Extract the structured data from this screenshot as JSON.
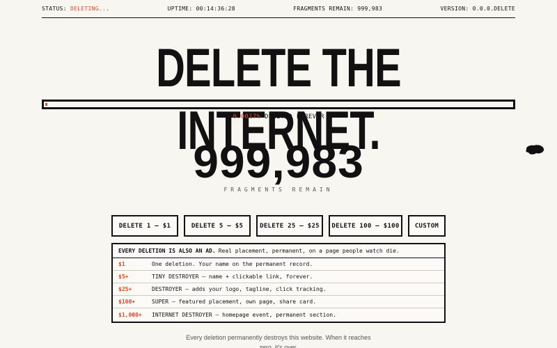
{
  "topbar": {
    "status_label": "STATUS:",
    "status_value": "DELETING...",
    "uptime": "UPTIME: 00:14:36:28",
    "fragments": "FRAGMENTS REMAIN: 999,983",
    "version": "VERSION: 0.0.0.DELETE"
  },
  "headline": "DELETE THE INTERNET.",
  "progress": {
    "fraction": 1.7e-05,
    "percent_text": "0.0017%",
    "label": "DELETED FOREVER"
  },
  "counter": {
    "value": "999,983",
    "label": "FRAGMENTS REMAIN"
  },
  "buttons": {
    "delete_1": "DELETE 1 — $1",
    "delete_5": "DELETE 5 — $5",
    "delete_25": "DELETE 25 — $25",
    "delete_100": "DELETE 100 — $100",
    "custom": "CUSTOM"
  },
  "tiers": {
    "header_strong": "EVERY DELETION IS ALSO AN AD.",
    "header_rest": "Real placement, permanent, on a page people watch die.",
    "rows": [
      {
        "price": "$1",
        "desc": "One deletion. Your name on the permanent record."
      },
      {
        "price": "$5+",
        "desc": "TINY DESTROYER — name + clickable link, forever."
      },
      {
        "price": "$25+",
        "desc": "DESTROYER — adds your logo, tagline, click tracking."
      },
      {
        "price": "$100+",
        "desc": "SUPER — featured placement, own page, share card."
      },
      {
        "price": "$1,000+",
        "desc": "INTERNET DESTROYER — homepage event, permanent section."
      }
    ]
  },
  "footer": {
    "line1": "Every deletion permanently destroys this website. When it reaches",
    "line2": "zero, it's over."
  },
  "colors": {
    "accent": "#e0471f",
    "background": "#f8f6f1",
    "ink": "#111111"
  }
}
